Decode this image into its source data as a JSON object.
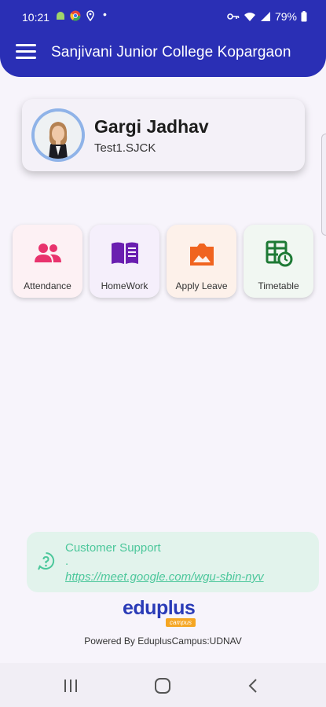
{
  "status_bar": {
    "time": "10:21",
    "dot": "•",
    "battery": "79%",
    "icons": [
      "android-icon",
      "chrome-icon",
      "location-icon",
      "vpn-icon",
      "wifi-icon",
      "signal-icon",
      "battery-icon"
    ]
  },
  "header": {
    "title": "Sanjivani Junior College Kopargaon",
    "menu_icon": "hamburger-menu-icon",
    "background": "#2a2fb5"
  },
  "profile": {
    "name": "Gargi Jadhav",
    "id": "Test1.SJCK"
  },
  "tiles": [
    {
      "label": "Attendance",
      "icon": "people-icon",
      "color": "#e8336d",
      "bg": "#fdf1f4"
    },
    {
      "label": "HomeWork",
      "icon": "book-icon",
      "color": "#6a1fb0",
      "bg": "#f5effb"
    },
    {
      "label": "Apply Leave",
      "icon": "leave-image-icon",
      "color": "#f0641f",
      "bg": "#fdf1ea"
    },
    {
      "label": "Timetable",
      "icon": "timetable-icon",
      "color": "#1e7a35",
      "bg": "#f1f7f2"
    }
  ],
  "support": {
    "title": "Customer Support",
    "separator": ".",
    "link": "https://meet.google.com/wgu-sbin-nyv",
    "color": "#4cc79b"
  },
  "brand": {
    "name": "eduplus",
    "sub": "campus"
  },
  "footer": {
    "powered_by": "Powered By EduplusCampus:UDNAV"
  },
  "nav": {
    "recents_icon": "recent-apps-icon",
    "home_icon": "home-icon",
    "back_icon": "back-icon"
  }
}
